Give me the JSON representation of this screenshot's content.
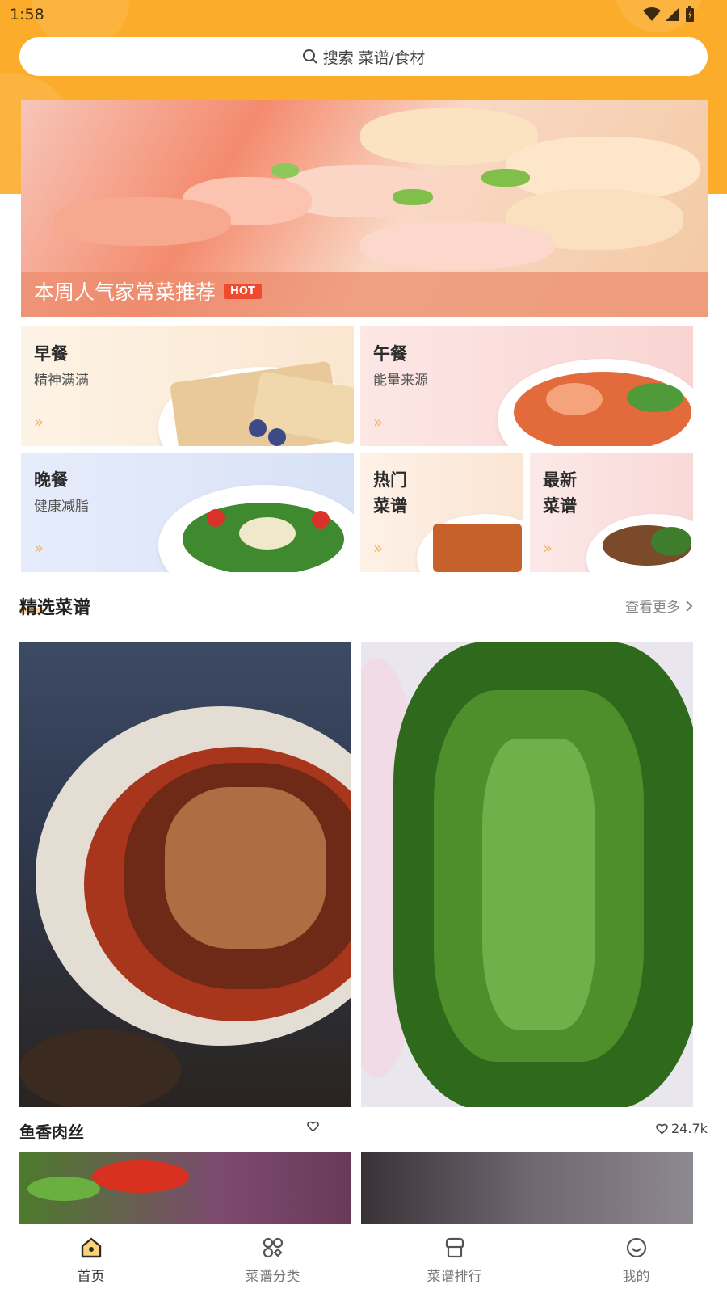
{
  "status": {
    "time": "1:58"
  },
  "search": {
    "placeholder": "搜索 菜谱/食材"
  },
  "hero": {
    "caption": "本周人气家常菜推荐",
    "badge": "HOT"
  },
  "meals": [
    {
      "title": "早餐",
      "subtitle": "精神满满"
    },
    {
      "title": "午餐",
      "subtitle": "能量来源"
    },
    {
      "title": "晚餐",
      "subtitle": "健康减脂"
    },
    {
      "title": "热门\n菜谱"
    },
    {
      "title": "最新\n菜谱"
    }
  ],
  "section": {
    "title": "精选菜谱",
    "more": "查看更多"
  },
  "recipes": [
    {
      "name": "鱼香肉丝",
      "likes": ""
    },
    {
      "name": "",
      "likes": "24.7k"
    }
  ],
  "nav": [
    {
      "label": "首页",
      "icon": "home-icon",
      "active": true
    },
    {
      "label": "菜谱分类",
      "icon": "category-icon"
    },
    {
      "label": "菜谱排行",
      "icon": "ranking-icon"
    },
    {
      "label": "我的",
      "icon": "profile-icon"
    }
  ],
  "colors": {
    "accent": "#fbac2a",
    "hot": "#f04a2e"
  }
}
